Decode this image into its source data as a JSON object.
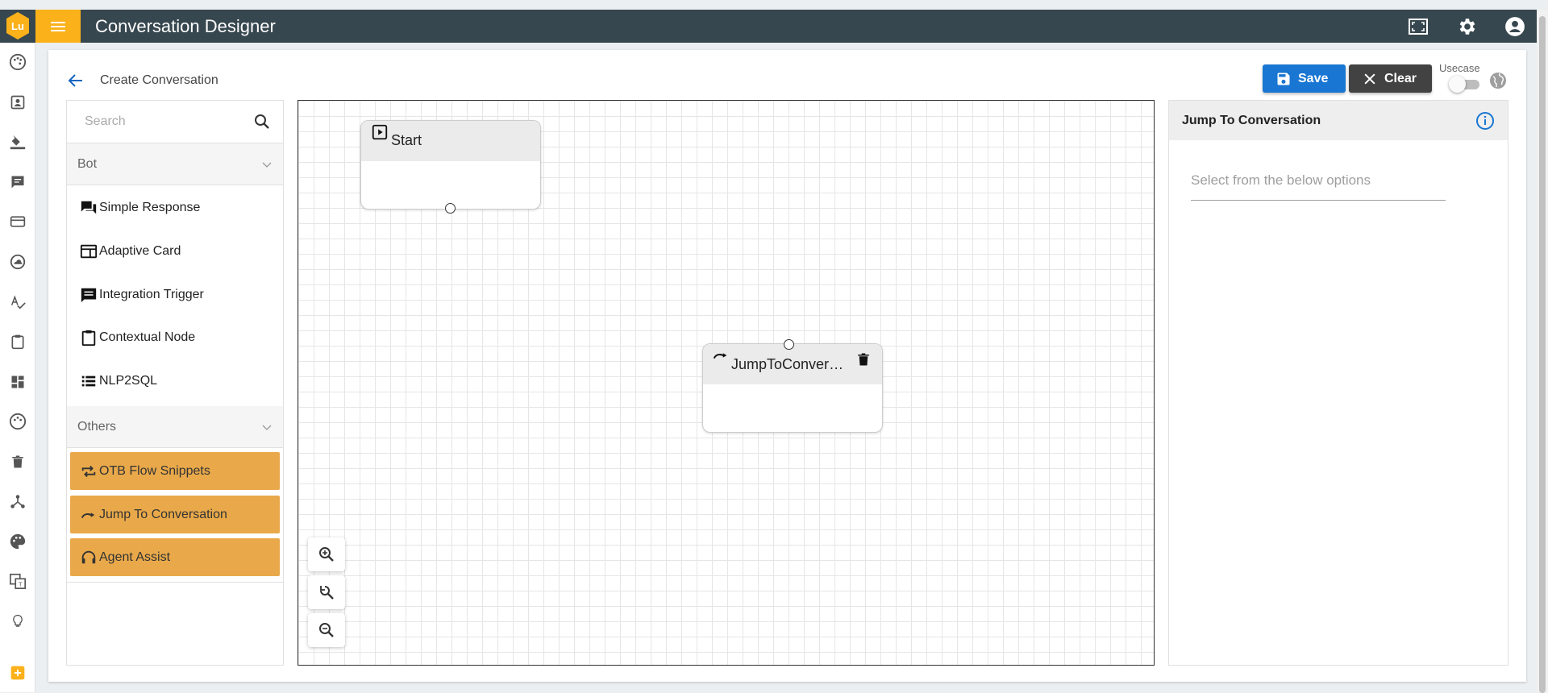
{
  "app": {
    "title": "Conversation Designer",
    "logo_text": "Lu"
  },
  "page": {
    "title": "Create Conversation"
  },
  "toolbar": {
    "save_label": "Save",
    "clear_label": "Clear",
    "usecase_label": "Usecase"
  },
  "palette": {
    "search_placeholder": "Search",
    "sections": [
      {
        "label": "Bot",
        "items": [
          {
            "label": "Simple Response",
            "icon": "chat-bubbles-icon"
          },
          {
            "label": "Adaptive Card",
            "icon": "card-icon"
          },
          {
            "label": "Integration Trigger",
            "icon": "message-icon"
          },
          {
            "label": "Contextual Node",
            "icon": "clipboard-icon"
          },
          {
            "label": "NLP2SQL",
            "icon": "list-icon"
          }
        ]
      },
      {
        "label": "Others",
        "items": [
          {
            "label": "OTB Flow Snippets",
            "icon": "repeat-icon"
          },
          {
            "label": "Jump To Conversation",
            "icon": "redo-arrow-icon"
          },
          {
            "label": "Agent Assist",
            "icon": "headset-icon"
          }
        ]
      }
    ]
  },
  "canvas": {
    "nodes": [
      {
        "label": "Start",
        "icon": "play-box-icon"
      },
      {
        "label": "JumpToConversation",
        "icon": "redo-arrow-icon"
      }
    ]
  },
  "properties": {
    "title": "Jump To Conversation",
    "select_placeholder": "Select from the below options"
  },
  "colors": {
    "topbar": "#37474f",
    "accent": "#fbb11a",
    "save": "#1976d2",
    "clear": "#424242",
    "palette_highlight": "#e9a94a"
  }
}
